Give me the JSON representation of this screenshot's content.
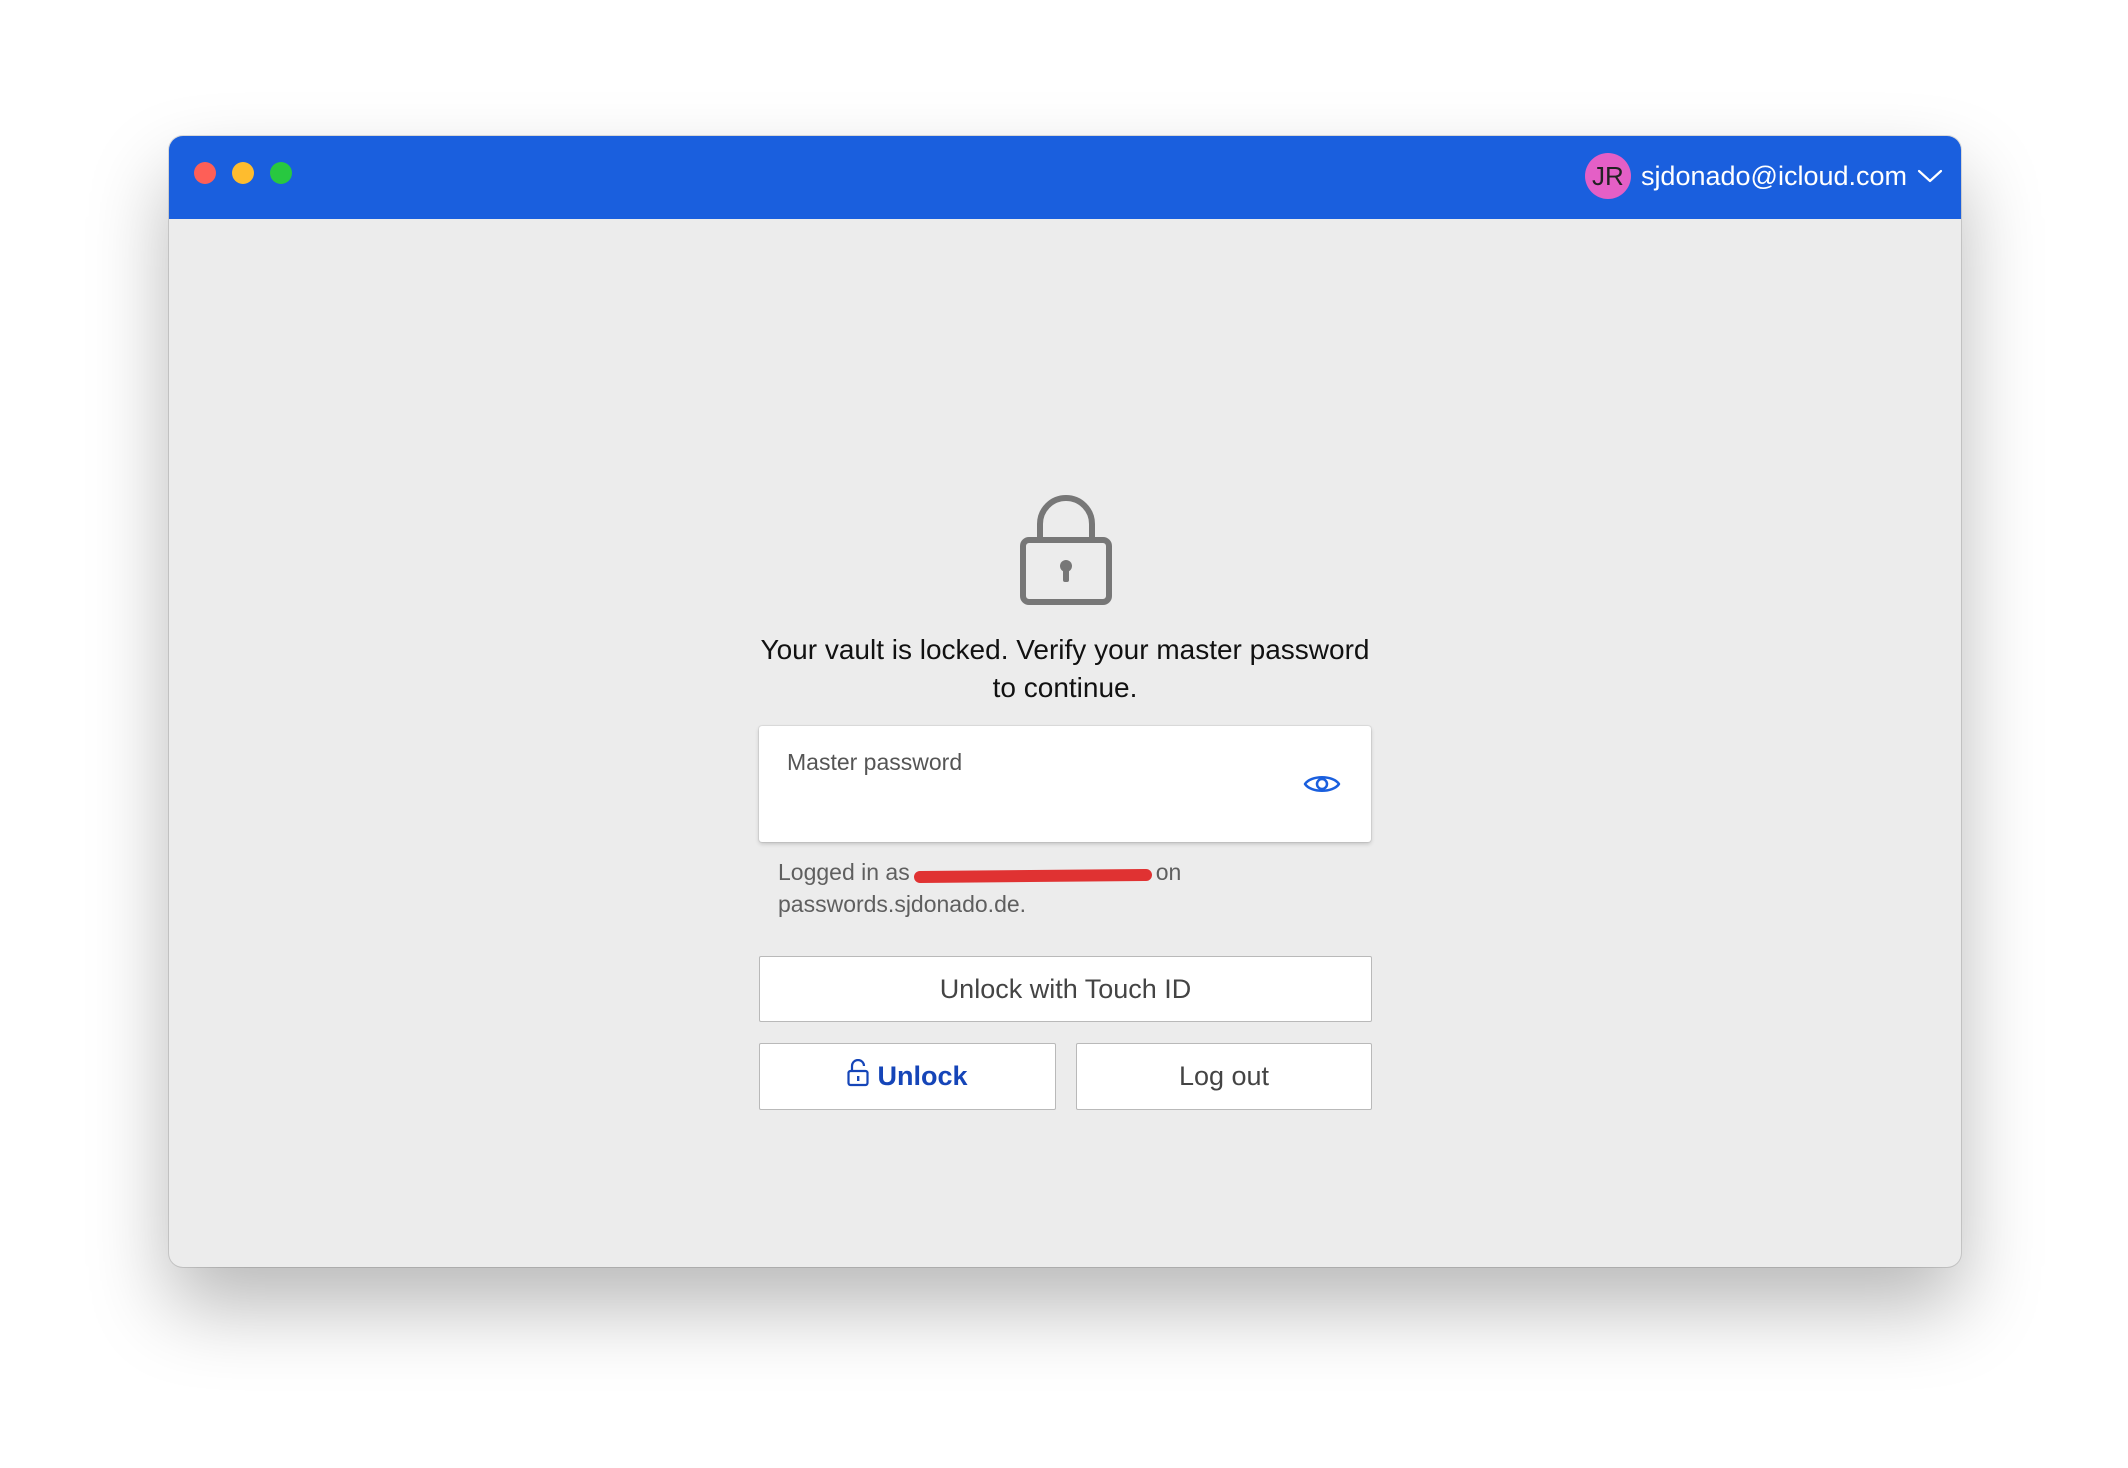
{
  "titlebar": {
    "accent_color": "#1a5fde",
    "window_controls": [
      "close",
      "minimize",
      "zoom"
    ]
  },
  "account": {
    "avatar_initials": "JR",
    "avatar_color": "#e45fc6",
    "email": "sjdonado@icloud.com",
    "menu_icon": "chevron-down-icon"
  },
  "lock_screen": {
    "icon": "lock-icon",
    "message": "Your vault is locked. Verify your master password to continue.",
    "password_field": {
      "label": "Master password",
      "value": "",
      "toggle_icon": "eye-icon"
    },
    "logged_in_prefix": "Logged in as",
    "logged_in_suffix": "on",
    "logged_in_server": "passwords.sjdonado.de.",
    "buttons": {
      "touch_id": "Unlock with Touch ID",
      "unlock": "Unlock",
      "logout": "Log out"
    }
  }
}
